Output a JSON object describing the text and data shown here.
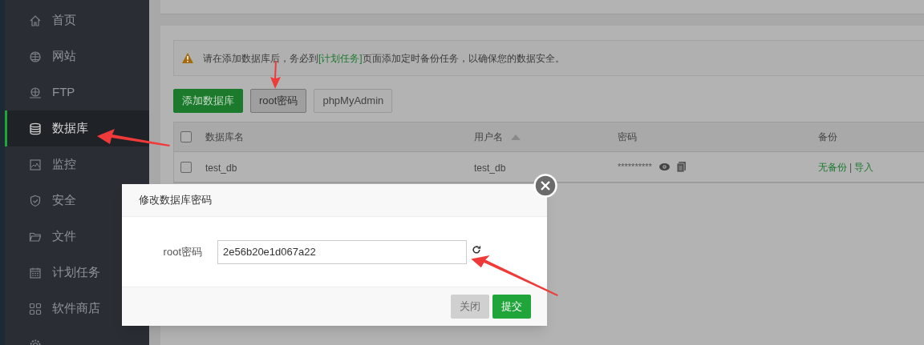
{
  "sidebar": {
    "items": [
      {
        "label": "首页",
        "selected": false
      },
      {
        "label": "网站",
        "selected": false
      },
      {
        "label": "FTP",
        "selected": false
      },
      {
        "label": "数据库",
        "selected": true
      },
      {
        "label": "监控",
        "selected": false
      },
      {
        "label": "安全",
        "selected": false
      },
      {
        "label": "文件",
        "selected": false
      },
      {
        "label": "计划任务",
        "selected": false
      },
      {
        "label": "软件商店",
        "selected": false
      }
    ]
  },
  "notice": {
    "before": "请在添加数据库后，务必到",
    "link": "[计划任务]",
    "after": "页面添加定时备份任务，以确保您的数据安全。"
  },
  "toolbar": [
    {
      "label": "添加数据库",
      "kind": "primary"
    },
    {
      "label": "root密码",
      "kind": "pressed"
    },
    {
      "label": "phpMyAdmin",
      "kind": "default"
    }
  ],
  "table": {
    "select_all": {
      "checked": false
    },
    "columns": [
      {
        "label": "数据库名",
        "sorted": false
      },
      {
        "label": "用户名",
        "sorted": true
      },
      {
        "label": "密码",
        "sorted": false
      },
      {
        "label": "备份",
        "sorted": false
      }
    ],
    "rows": [
      {
        "checked": false,
        "name": "test_db",
        "user": "test_db",
        "password": "**********",
        "backup": "无备份",
        "separator": "|",
        "import": "导入"
      }
    ]
  },
  "modal": {
    "title": "修改数据库密码",
    "field_label": "root密码",
    "value": "2e56b20e1d067a22",
    "buttons": [
      {
        "label": "关闭",
        "kind": "disabled"
      },
      {
        "label": "提交",
        "kind": "primary"
      }
    ]
  }
}
